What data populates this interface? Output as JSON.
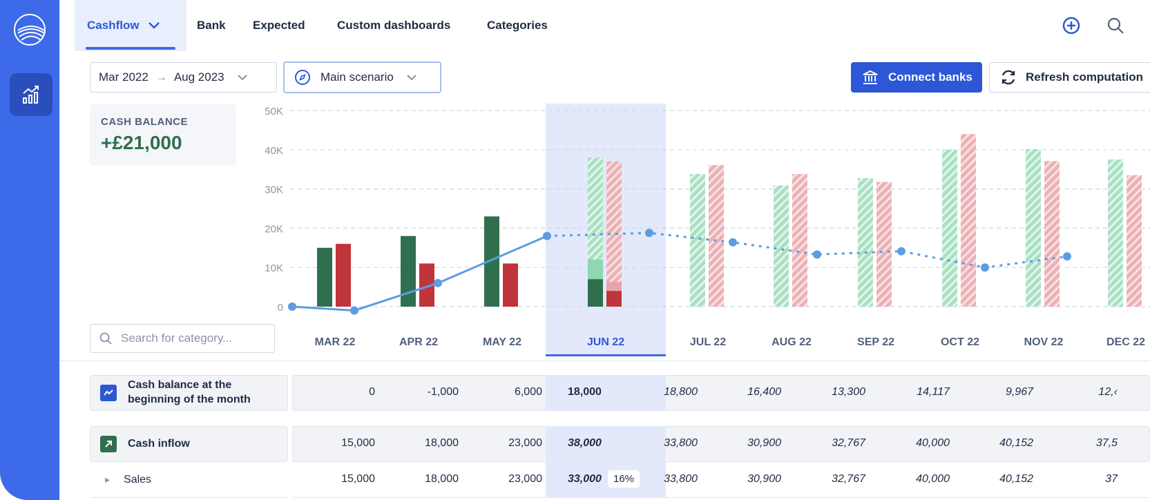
{
  "nav": {
    "tabs": [
      {
        "label": "Cashflow"
      },
      {
        "label": "Bank"
      },
      {
        "label": "Expected"
      },
      {
        "label": "Custom dashboards"
      },
      {
        "label": "Categories"
      }
    ],
    "accent_color": "#3d6ae8"
  },
  "toolbar": {
    "date_from": "Mar 2022",
    "date_to": "Aug 2023",
    "scenario": "Main scenario",
    "connect_label": "Connect banks",
    "refresh_label": "Refresh computation"
  },
  "balance": {
    "title": "CASH BALANCE",
    "value": "+£21,000",
    "value_color": "#2f6f4e"
  },
  "search": {
    "placeholder": "Search for category..."
  },
  "chart_data": {
    "type": "bar",
    "categories": [
      "MAR 22",
      "APR 22",
      "MAY 22",
      "JUN 22",
      "JUL 22",
      "AUG 22",
      "SEP 22",
      "OCT 22",
      "NOV 22",
      "DEC 22"
    ],
    "y_ticks": [
      "0",
      "10K",
      "20K",
      "30K",
      "40K",
      "50K"
    ],
    "ylim": [
      0,
      50000
    ],
    "selected_category": "JUN 22",
    "series": [
      {
        "type": "bar",
        "color": "#2f6f4e",
        "values": [
          15000,
          18000,
          23000,
          38000,
          33800,
          30900,
          32767,
          40000,
          40152,
          37500
        ],
        "projected_from": 3,
        "actual_part": {
          "3": 7000,
          "3b": 12000
        }
      },
      {
        "type": "bar",
        "color": "#c0343b",
        "values": [
          16000,
          11000,
          11000,
          37000,
          36100,
          33800,
          31800,
          44000,
          37100,
          33500
        ],
        "projected_from": 3,
        "actual_part": {
          "3": 4000,
          "3b": 6300
        }
      },
      {
        "type": "line",
        "color": "#5b9ce3",
        "values": [
          0,
          -1000,
          6000,
          18000,
          18800,
          16400,
          13300,
          14117,
          9967,
          12800
        ],
        "dashed_from": 3
      }
    ]
  },
  "table": {
    "rows": [
      {
        "label": "Cash balance at the beginning of the month",
        "label_line1": "Cash balance at the",
        "label_line2": "beginning of the month",
        "icon": "trend-line-icon",
        "values": [
          "0",
          "-1,000",
          "6,000",
          "18,000",
          "18,800",
          "16,400",
          "13,300",
          "14,117",
          "9,967",
          "12,‹"
        ]
      },
      {
        "label": "Cash inflow",
        "icon": "arrow-up-right-icon",
        "values": [
          "15,000",
          "18,000",
          "23,000",
          "38,000",
          "33,800",
          "30,900",
          "32,767",
          "40,000",
          "40,152",
          "37,5"
        ]
      },
      {
        "label": "Sales",
        "icon": "caret-right-icon",
        "values": [
          "15,000",
          "18,000",
          "23,000",
          "33,000",
          "33,800",
          "30,900",
          "32,767",
          "40,000",
          "40,152",
          "37"
        ],
        "selected_badge": "16%"
      }
    ]
  }
}
